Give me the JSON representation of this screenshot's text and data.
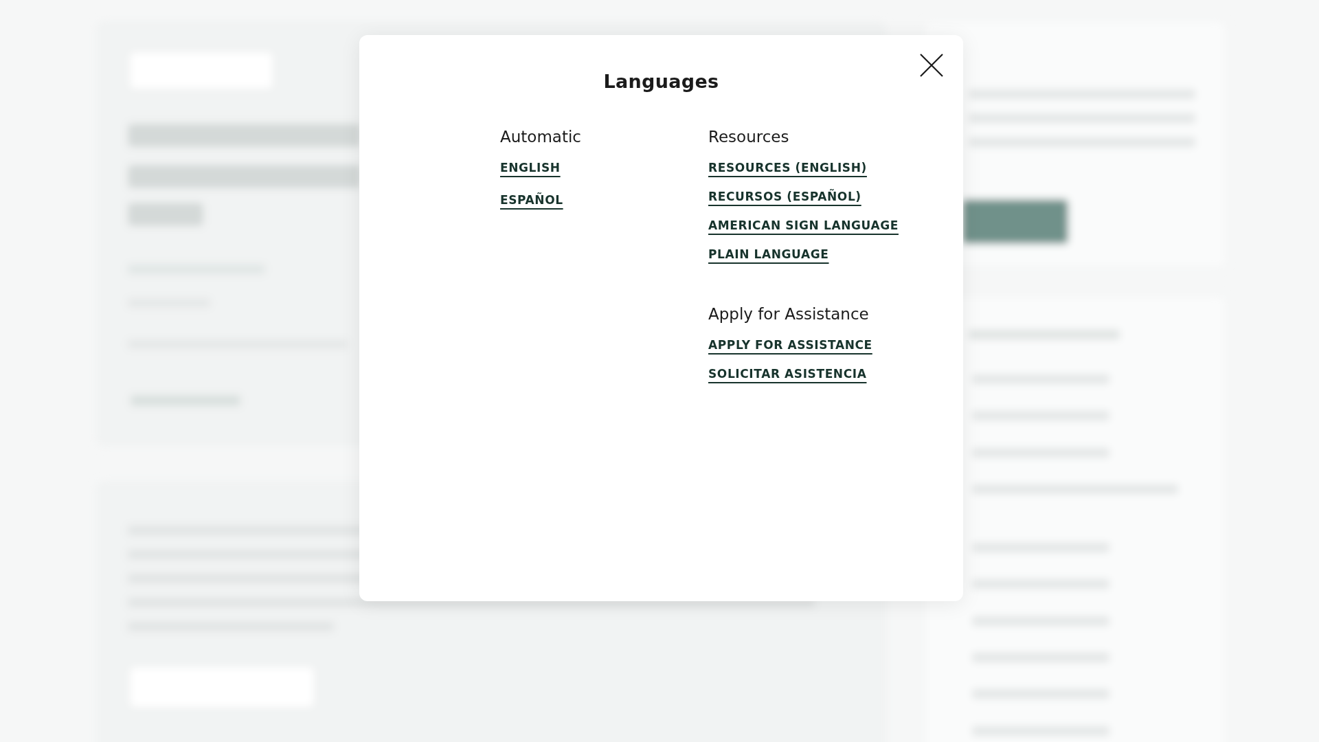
{
  "dialog": {
    "title": "Languages",
    "columns": [
      {
        "sections": [
          {
            "heading": "Automatic",
            "links": [
              "ENGLISH",
              "ESPAÑOL"
            ]
          }
        ]
      },
      {
        "sections": [
          {
            "heading": "Resources",
            "links": [
              "RESOURCES (ENGLISH)",
              "RECURSOS (ESPAÑOL)",
              "AMERICAN SIGN LANGUAGE",
              "PLAIN LANGUAGE"
            ]
          },
          {
            "heading": "Apply for Assistance",
            "links": [
              "APPLY FOR ASSISTANCE",
              "SOLICITAR ASISTENCIA"
            ]
          }
        ]
      }
    ]
  }
}
